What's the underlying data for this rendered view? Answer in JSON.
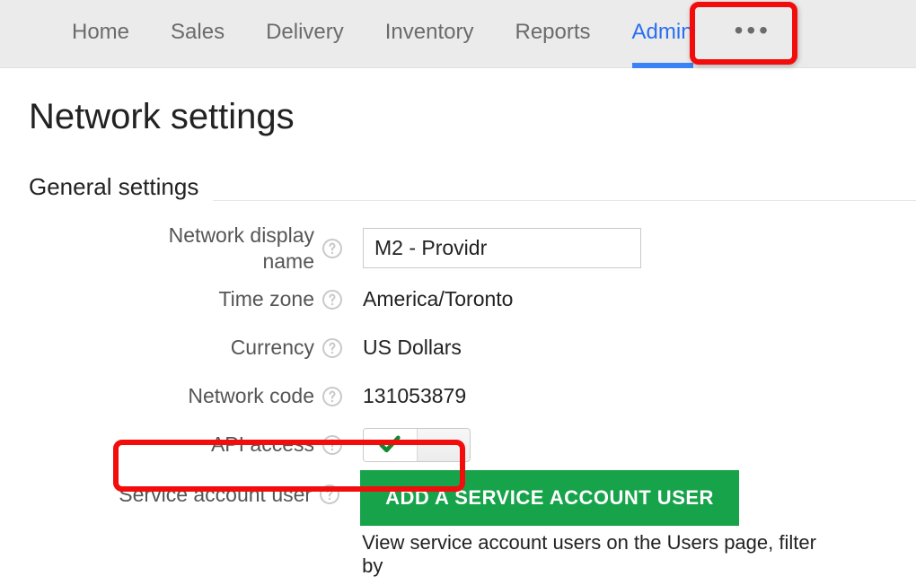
{
  "tabs": {
    "home": "Home",
    "sales": "Sales",
    "delivery": "Delivery",
    "inventory": "Inventory",
    "reports": "Reports",
    "admin": "Admin",
    "more": "•••"
  },
  "page": {
    "title": "Network settings",
    "section_general": "General settings"
  },
  "general": {
    "network_display_name_label": "Network display\nname",
    "network_display_name_value": "M2 - Providr",
    "time_zone_label": "Time zone",
    "time_zone_value": "America/Toronto",
    "currency_label": "Currency",
    "currency_value": "US Dollars",
    "network_code_label": "Network code",
    "network_code_value": "131053879",
    "api_access_label": "API access",
    "api_access_on": true,
    "service_account_user_label": "Service account user",
    "add_service_account_user_button": "ADD A SERVICE ACCOUNT USER",
    "service_account_hint": "View service account users on the Users page, filter by "
  },
  "icons": {
    "help": "help-circle"
  }
}
